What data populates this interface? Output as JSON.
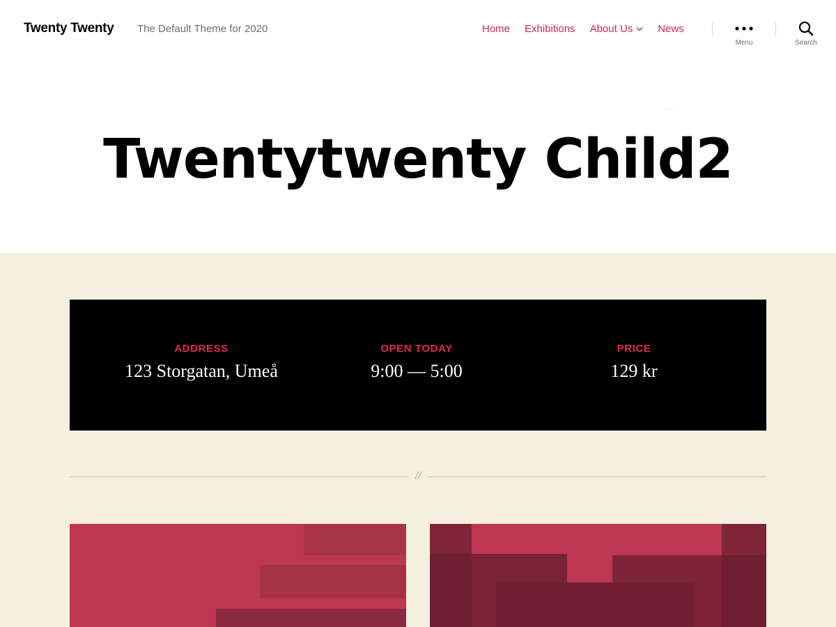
{
  "header": {
    "site_title": "Twenty Twenty",
    "site_description": "The Default Theme for 2020",
    "nav": [
      {
        "label": "Home"
      },
      {
        "label": "Exhibitions"
      },
      {
        "label": "About Us",
        "has_submenu": true
      },
      {
        "label": "News"
      }
    ],
    "menu_toggle_label": "Menu",
    "search_toggle_label": "Search"
  },
  "hero": {
    "title": "Twentytwenty Child2"
  },
  "info_bar": {
    "items": [
      {
        "label": "ADDRESS",
        "value": "123 Storgatan, Umeå"
      },
      {
        "label": "OPEN TODAY",
        "value": "9:00 — 5:00"
      },
      {
        "label": "PRICE",
        "value": "129 kr"
      }
    ]
  },
  "separator": {
    "glyph": "//"
  },
  "colors": {
    "accent": "#cd2653",
    "info_label": "#e22658",
    "content_bg": "#f5efe0",
    "info_bg": "#000000",
    "card_base": "#bd3653"
  },
  "icons": {
    "menu": "ellipsis-icon",
    "search": "search-icon",
    "submenu": "chevron-down-icon"
  }
}
